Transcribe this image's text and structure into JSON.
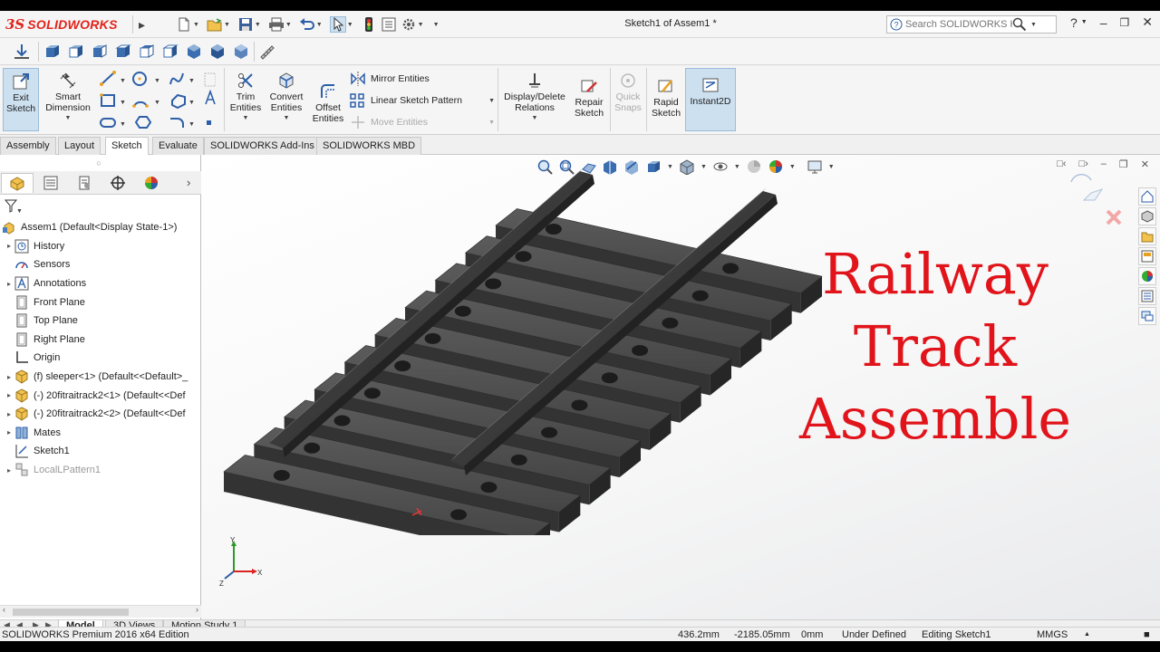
{
  "app": {
    "logo_ds": "3S",
    "logo_text": "SOLIDWORKS",
    "document_title": "Sketch1 of Assem1 *",
    "help_search_placeholder": "Search SOLIDWORKS Help",
    "help_label": "?"
  },
  "command_manager": {
    "exit_sketch": "Exit\nSketch",
    "smart_dimension": "Smart\nDimension",
    "trim_entities": "Trim\nEntities",
    "convert_entities": "Convert\nEntities",
    "offset_entities": "Offset\nEntities",
    "mirror_entities": "Mirror Entities",
    "linear_sketch_pattern": "Linear Sketch Pattern",
    "move_entities": "Move Entities",
    "display_delete_relations": "Display/Delete\nRelations",
    "repair_sketch": "Repair\nSketch",
    "quick_snaps": "Quick\nSnaps",
    "rapid_sketch": "Rapid\nSketch",
    "instant2d": "Instant2D"
  },
  "tabs": [
    "Assembly",
    "Layout",
    "Sketch",
    "Evaluate",
    "SOLIDWORKS Add-Ins",
    "SOLIDWORKS MBD"
  ],
  "active_tab": "Sketch",
  "feature_tree": {
    "root": "Assem1  (Default<Display State-1>)",
    "items": [
      {
        "label": "History",
        "expandable": true,
        "icon": "history-icon"
      },
      {
        "label": "Sensors",
        "expandable": false,
        "icon": "sensor-icon"
      },
      {
        "label": "Annotations",
        "expandable": true,
        "icon": "annotation-icon"
      },
      {
        "label": "Front Plane",
        "expandable": false,
        "icon": "plane-icon"
      },
      {
        "label": "Top Plane",
        "expandable": false,
        "icon": "plane-icon"
      },
      {
        "label": "Right Plane",
        "expandable": false,
        "icon": "plane-icon"
      },
      {
        "label": "Origin",
        "expandable": false,
        "icon": "origin-icon"
      },
      {
        "label": "(f) sleeper<1> (Default<<Default>_",
        "expandable": true,
        "icon": "part-icon"
      },
      {
        "label": "(-) 20fitraitrack2<1> (Default<<Def",
        "expandable": true,
        "icon": "part-icon"
      },
      {
        "label": "(-) 20fitraitrack2<2> (Default<<Def",
        "expandable": true,
        "icon": "part-icon"
      },
      {
        "label": "Mates",
        "expandable": true,
        "icon": "mates-icon"
      },
      {
        "label": "Sketch1",
        "expandable": false,
        "icon": "sketch-icon"
      },
      {
        "label": "LocalLPattern1",
        "expandable": true,
        "icon": "pattern-icon",
        "dim": true
      }
    ]
  },
  "overlay_text": [
    "Railway",
    "Track",
    "Assemble"
  ],
  "triad": {
    "x": "X",
    "y": "Y",
    "z": "Z"
  },
  "bottom_tabs": [
    "Model",
    "3D Views",
    "Motion Study 1"
  ],
  "active_bottom_tab": "Model",
  "status": {
    "edition": "SOLIDWORKS Premium 2016 x64 Edition",
    "x": "436.2mm",
    "y": "-2185.05mm",
    "z": "0mm",
    "state": "Under Defined",
    "editing": "Editing Sketch1",
    "units": "MMGS"
  },
  "colors": {
    "brand_red": "#e2231a",
    "overlay_red": "#e0141a",
    "rail_dark": "#3a3a3a",
    "active_blue": "#cde0f0"
  }
}
